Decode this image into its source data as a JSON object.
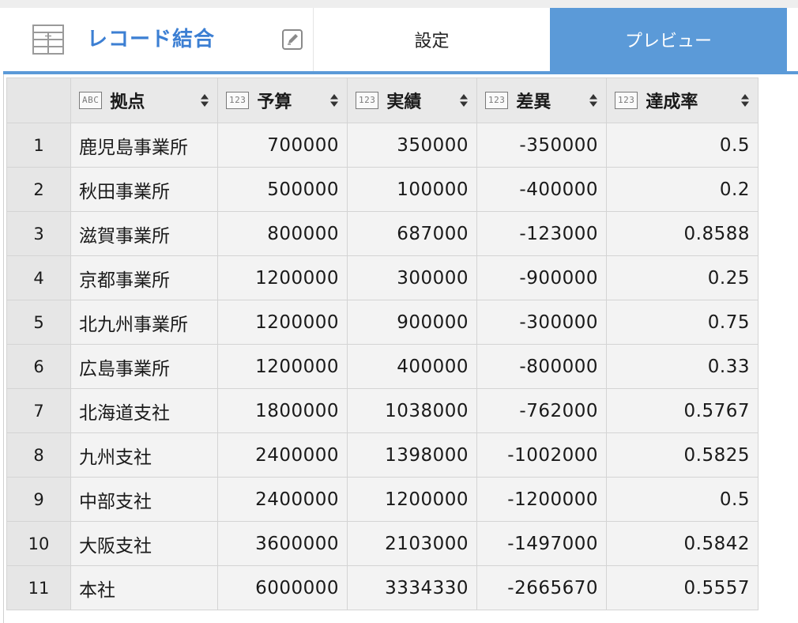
{
  "node": {
    "title": "レコード結合",
    "icon": "table-node-icon",
    "edit_icon": "pencil-edit-icon"
  },
  "tabs": [
    {
      "label": "設定",
      "active": false
    },
    {
      "label": "プレビュー",
      "active": true
    }
  ],
  "colors": {
    "accent": "#5b9ad8",
    "title": "#3c7fd3",
    "header_bg": "#e9e9e9",
    "cell_bg": "#f3f3f3"
  },
  "table": {
    "columns": [
      {
        "type": "ABC",
        "name": "拠点"
      },
      {
        "type": "123",
        "name": "予算"
      },
      {
        "type": "123",
        "name": "実績"
      },
      {
        "type": "123",
        "name": "差異"
      },
      {
        "type": "123",
        "name": "達成率"
      }
    ],
    "rows": [
      {
        "n": "1",
        "c": [
          "鹿児島事業所",
          "700000",
          "350000",
          "-350000",
          "0.5"
        ]
      },
      {
        "n": "2",
        "c": [
          "秋田事業所",
          "500000",
          "100000",
          "-400000",
          "0.2"
        ]
      },
      {
        "n": "3",
        "c": [
          "滋賀事業所",
          "800000",
          "687000",
          "-123000",
          "0.8588"
        ]
      },
      {
        "n": "4",
        "c": [
          "京都事業所",
          "1200000",
          "300000",
          "-900000",
          "0.25"
        ]
      },
      {
        "n": "5",
        "c": [
          "北九州事業所",
          "1200000",
          "900000",
          "-300000",
          "0.75"
        ]
      },
      {
        "n": "6",
        "c": [
          "広島事業所",
          "1200000",
          "400000",
          "-800000",
          "0.33"
        ]
      },
      {
        "n": "7",
        "c": [
          "北海道支社",
          "1800000",
          "1038000",
          "-762000",
          "0.5767"
        ]
      },
      {
        "n": "8",
        "c": [
          "九州支社",
          "2400000",
          "1398000",
          "-1002000",
          "0.5825"
        ]
      },
      {
        "n": "9",
        "c": [
          "中部支社",
          "2400000",
          "1200000",
          "-1200000",
          "0.5"
        ]
      },
      {
        "n": "10",
        "c": [
          "大阪支社",
          "3600000",
          "2103000",
          "-1497000",
          "0.5842"
        ]
      },
      {
        "n": "11",
        "c": [
          "本社",
          "6000000",
          "3334330",
          "-2665670",
          "0.5557"
        ]
      }
    ]
  }
}
